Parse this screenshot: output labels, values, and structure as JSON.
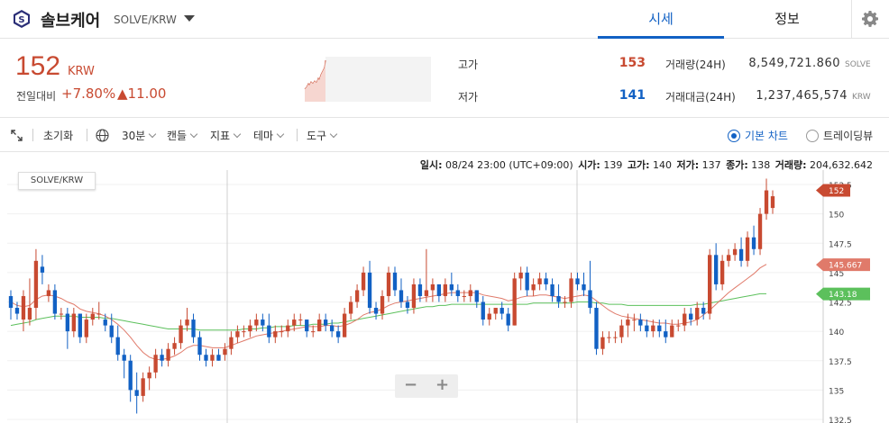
{
  "header": {
    "coin_name": "솔브케어",
    "pair": "SOLVE/KRW",
    "logo_letter": "S",
    "tabs": [
      {
        "label": "시세",
        "active": true
      },
      {
        "label": "정보",
        "active": false
      }
    ]
  },
  "summary": {
    "price": "152",
    "price_unit": "KRW",
    "change_label": "전일대비",
    "change_rate": "+7.80%",
    "change_amount": "▲11.00",
    "high_label": "고가",
    "high_value": "153",
    "low_label": "저가",
    "low_value": "141",
    "volume_label": "거래량(24H)",
    "volume_value": "8,549,721.860",
    "volume_unit": "SOLVE",
    "amount_label": "거래대금(24H)",
    "amount_value": "1,237,465,574",
    "amount_unit": "KRW"
  },
  "toolbar": {
    "reset_label": "초기화",
    "interval_label": "30분",
    "candle_label": "캔들",
    "indicator_label": "지표",
    "theme_label": "테마",
    "tools_label": "도구",
    "basic_chart_label": "기본 차트",
    "tradingview_label": "트레이딩뷰"
  },
  "ohlc_line": {
    "time_label": "일시:",
    "time_value": "08/24 23:00 (UTC+09:00)",
    "open_label": "시가:",
    "open_value": "139",
    "high_label": "고가:",
    "high_value": "140",
    "low_label": "저가:",
    "low_value": "137",
    "close_label": "종가:",
    "close_value": "138",
    "volume_label": "거래량:",
    "volume_value": "204,632.642"
  },
  "chart_symbol": "SOLVE/KRW",
  "colors": {
    "up": "#c84a31",
    "down": "#1261c4",
    "ma_short": "#e07a6a",
    "ma_long": "#5cc05c",
    "accent": "#1261c4"
  },
  "chart_data": {
    "type": "candlestick",
    "ylim": [
      132.5,
      152.5
    ],
    "y_ticks": [
      132.5,
      135,
      137.5,
      140,
      142.5,
      145,
      147.5,
      150,
      152.5
    ],
    "price_tags": [
      {
        "value": 152,
        "label": "152",
        "color": "#c84a31"
      },
      {
        "value": 145.667,
        "label": "145.667",
        "color": "#e07a6a"
      },
      {
        "value": 143.18,
        "label": "143.18",
        "color": "#5cc05c"
      }
    ],
    "candles": [
      [
        143,
        143.5,
        141,
        142
      ],
      [
        142,
        142.5,
        141,
        141.5
      ],
      [
        141,
        143.5,
        140,
        143
      ],
      [
        141,
        144.5,
        140.5,
        142
      ],
      [
        142,
        147,
        141,
        146
      ],
      [
        145.5,
        146.5,
        144,
        145
      ],
      [
        143,
        144,
        142.5,
        143.5
      ],
      [
        143.5,
        144,
        141,
        141.5
      ],
      [
        141.5,
        142,
        141,
        141.5
      ],
      [
        141.5,
        142,
        138.5,
        140
      ],
      [
        140,
        142,
        139.5,
        141.5
      ],
      [
        141.5,
        141.5,
        139,
        139.5
      ],
      [
        139.5,
        141.5,
        139,
        141
      ],
      [
        141,
        142,
        140.5,
        141.5
      ],
      [
        141.5,
        142.5,
        141,
        141.5
      ],
      [
        141,
        141.5,
        140,
        140.5
      ],
      [
        140.5,
        141.5,
        139,
        139.5
      ],
      [
        139.5,
        140.5,
        137.5,
        138
      ],
      [
        138,
        138.5,
        136,
        137.5
      ],
      [
        137.5,
        138,
        134,
        135
      ],
      [
        135,
        136.5,
        133,
        134.5
      ],
      [
        134.5,
        136.5,
        134,
        136
      ],
      [
        136,
        137,
        135,
        136.5
      ],
      [
        136.5,
        138.5,
        136,
        138
      ],
      [
        138,
        138.5,
        137,
        137.5
      ],
      [
        137.5,
        139,
        137,
        138.5
      ],
      [
        138.5,
        139.5,
        138,
        139
      ],
      [
        139,
        141,
        138.5,
        140.5
      ],
      [
        140.5,
        142,
        140,
        141
      ],
      [
        141,
        141.5,
        139,
        139.5
      ],
      [
        139.5,
        140,
        137.5,
        138
      ],
      [
        138,
        138.5,
        137,
        137.5
      ],
      [
        137.5,
        138.5,
        137,
        138
      ],
      [
        138,
        138.5,
        137.5,
        137.5
      ],
      [
        138,
        139,
        137.5,
        138.5
      ],
      [
        138.5,
        140,
        138,
        139.5
      ],
      [
        139.5,
        140.5,
        139,
        140
      ],
      [
        140,
        140.5,
        139.5,
        140
      ],
      [
        140,
        141,
        139.5,
        140.5
      ],
      [
        140.5,
        141.5,
        140,
        141
      ],
      [
        141,
        141.5,
        140,
        140.5
      ],
      [
        140.5,
        141.5,
        139,
        139.5
      ],
      [
        139.5,
        140.5,
        139,
        140
      ],
      [
        140,
        140.5,
        139.5,
        140
      ],
      [
        140,
        141,
        139.5,
        140.5
      ],
      [
        140.5,
        141.5,
        140,
        141
      ],
      [
        141,
        141.5,
        140.5,
        141
      ],
      [
        141,
        141,
        139.5,
        140
      ],
      [
        140,
        140.5,
        139.5,
        140
      ],
      [
        140,
        141.5,
        140,
        141
      ],
      [
        141,
        141.5,
        140,
        140.5
      ],
      [
        140.5,
        141,
        139.5,
        140
      ],
      [
        140,
        140.5,
        139,
        139.5
      ],
      [
        139.5,
        142,
        139.5,
        141.5
      ],
      [
        141.5,
        143,
        141,
        142.5
      ],
      [
        142.5,
        144,
        142,
        143.5
      ],
      [
        143.5,
        145.5,
        143,
        145
      ],
      [
        145,
        146,
        141.5,
        142
      ],
      [
        142,
        142.5,
        141,
        141.5
      ],
      [
        141.5,
        143.5,
        141,
        143
      ],
      [
        143,
        145.5,
        142.5,
        145
      ],
      [
        145,
        145.5,
        143,
        143.5
      ],
      [
        143.5,
        144.5,
        142,
        142.5
      ],
      [
        142.5,
        143,
        141.5,
        142
      ],
      [
        142,
        144.5,
        141.5,
        144
      ],
      [
        144,
        144.5,
        142.5,
        143
      ],
      [
        143,
        147,
        142.5,
        143.5
      ],
      [
        143.5,
        144.5,
        142.5,
        144
      ],
      [
        144,
        144,
        142.5,
        143
      ],
      [
        143,
        144.5,
        142.5,
        144
      ],
      [
        144,
        145,
        143,
        143.5
      ],
      [
        143.5,
        144,
        142.5,
        143
      ],
      [
        143,
        143.5,
        142.5,
        143
      ],
      [
        143,
        144,
        142.5,
        143.5
      ],
      [
        143.5,
        143.5,
        142,
        142.5
      ],
      [
        142.5,
        143,
        140.5,
        141
      ],
      [
        141,
        142,
        140.5,
        141.5
      ],
      [
        141.5,
        142,
        141,
        142
      ],
      [
        142,
        142.5,
        141,
        141.5
      ],
      [
        141.5,
        142,
        140,
        140.5
      ],
      [
        140.5,
        145,
        140.5,
        144.5
      ],
      [
        144.5,
        145.5,
        143.5,
        145
      ],
      [
        145,
        145.5,
        143,
        143.5
      ],
      [
        143.5,
        144.5,
        143,
        144
      ],
      [
        144,
        145,
        143.5,
        144.5
      ],
      [
        144.5,
        145,
        143.5,
        144
      ],
      [
        144,
        144.5,
        142.5,
        143
      ],
      [
        143,
        144,
        142,
        142.5
      ],
      [
        142.5,
        143,
        142,
        142.5
      ],
      [
        142.5,
        145,
        142,
        144.5
      ],
      [
        144.5,
        145,
        143.5,
        144
      ],
      [
        144,
        145,
        143,
        143.5
      ],
      [
        143.5,
        146,
        141.5,
        142
      ],
      [
        142,
        142.5,
        138,
        138.5
      ],
      [
        138.5,
        140,
        138,
        139.5
      ],
      [
        139.5,
        140,
        139,
        139.5
      ],
      [
        139.5,
        140,
        139,
        139.5
      ],
      [
        139.5,
        141,
        139,
        140.5
      ],
      [
        140.5,
        141.5,
        139.5,
        141
      ],
      [
        141,
        141.5,
        140,
        141
      ],
      [
        141,
        141.5,
        140,
        140.5
      ],
      [
        140.5,
        141,
        139.5,
        140
      ],
      [
        140,
        141,
        139.5,
        140.5
      ],
      [
        140.5,
        141,
        139.5,
        140
      ],
      [
        140,
        141,
        139,
        139.5
      ],
      [
        139.5,
        141,
        139.5,
        140.5
      ],
      [
        140.5,
        141,
        140,
        140.5
      ],
      [
        140.5,
        142,
        140,
        141.5
      ],
      [
        141.5,
        142,
        140.5,
        141
      ],
      [
        141,
        142.5,
        140.5,
        142
      ],
      [
        142,
        142.5,
        141,
        141.5
      ],
      [
        141.5,
        147,
        141,
        146.5
      ],
      [
        146.5,
        147.5,
        143.5,
        144
      ],
      [
        144,
        146.5,
        143.5,
        146
      ],
      [
        146,
        147,
        145.5,
        146.5
      ],
      [
        146.5,
        147.5,
        146,
        147
      ],
      [
        147,
        148,
        145.5,
        146
      ],
      [
        146,
        148.5,
        145.5,
        148
      ],
      [
        148,
        149,
        146.5,
        147
      ],
      [
        147,
        150.5,
        146.5,
        150
      ],
      [
        150,
        153,
        149.5,
        152
      ],
      [
        150.5,
        152,
        150,
        151.5
      ]
    ],
    "ma_short": [
      142.5,
      142.2,
      142.1,
      142.2,
      142.7,
      143,
      143.1,
      143,
      142.8,
      142.5,
      142.3,
      141.9,
      141.7,
      141.6,
      141.5,
      141.3,
      141,
      140.6,
      140.1,
      139.5,
      138.8,
      138.2,
      137.8,
      137.6,
      137.6,
      137.7,
      137.9,
      138.2,
      138.6,
      138.8,
      138.8,
      138.7,
      138.6,
      138.6,
      138.6,
      138.8,
      139,
      139.2,
      139.4,
      139.6,
      139.7,
      139.8,
      139.9,
      140,
      140.1,
      140.2,
      140.3,
      140.4,
      140.4,
      140.4,
      140.5,
      140.5,
      140.4,
      140.5,
      140.7,
      141,
      141.4,
      141.6,
      141.7,
      141.9,
      142.2,
      142.4,
      142.5,
      142.6,
      142.7,
      142.8,
      142.9,
      143,
      143.1,
      143.2,
      143.3,
      143.3,
      143.3,
      143.3,
      143.3,
      143.1,
      143,
      142.9,
      142.8,
      142.6,
      142.7,
      142.9,
      143,
      143,
      143.1,
      143.1,
      143,
      142.9,
      142.8,
      142.9,
      143,
      143.1,
      143,
      142.6,
      142.2,
      141.8,
      141.5,
      141.3,
      141.2,
      141.1,
      141,
      140.9,
      140.8,
      140.7,
      140.7,
      140.6,
      140.6,
      140.7,
      140.8,
      141,
      141.4,
      141.8,
      142.3,
      142.8,
      143.3,
      143.7,
      144.1,
      144.5,
      144.9,
      145.4,
      145.7
    ],
    "ma_long": [
      140.5,
      140.6,
      140.7,
      140.8,
      141,
      141.1,
      141.2,
      141.3,
      141.3,
      141.3,
      141.3,
      141.2,
      141.2,
      141.2,
      141.2,
      141.1,
      141.1,
      141,
      140.9,
      140.8,
      140.7,
      140.6,
      140.5,
      140.4,
      140.3,
      140.2,
      140.2,
      140.2,
      140.2,
      140.2,
      140.1,
      140.1,
      140.1,
      140.1,
      140.1,
      140.1,
      140.1,
      140.2,
      140.2,
      140.2,
      140.3,
      140.3,
      140.4,
      140.4,
      140.4,
      140.5,
      140.5,
      140.5,
      140.6,
      140.6,
      140.6,
      140.7,
      140.7,
      140.8,
      140.9,
      141,
      141.1,
      141.2,
      141.3,
      141.4,
      141.5,
      141.6,
      141.7,
      141.8,
      141.9,
      142,
      142.1,
      142.1,
      142.2,
      142.2,
      142.3,
      142.3,
      142.3,
      142.3,
      142.3,
      142.3,
      142.3,
      142.3,
      142.3,
      142.3,
      142.3,
      142.3,
      142.3,
      142.4,
      142.4,
      142.4,
      142.4,
      142.4,
      142.4,
      142.4,
      142.5,
      142.5,
      142.5,
      142.4,
      142.4,
      142.3,
      142.3,
      142.3,
      142.2,
      142.2,
      142.2,
      142.2,
      142.2,
      142.2,
      142.2,
      142.2,
      142.2,
      142.2,
      142.2,
      142.3,
      142.3,
      142.4,
      142.5,
      142.6,
      142.7,
      142.8,
      142.9,
      143,
      143.1,
      143.2,
      143.2
    ]
  }
}
